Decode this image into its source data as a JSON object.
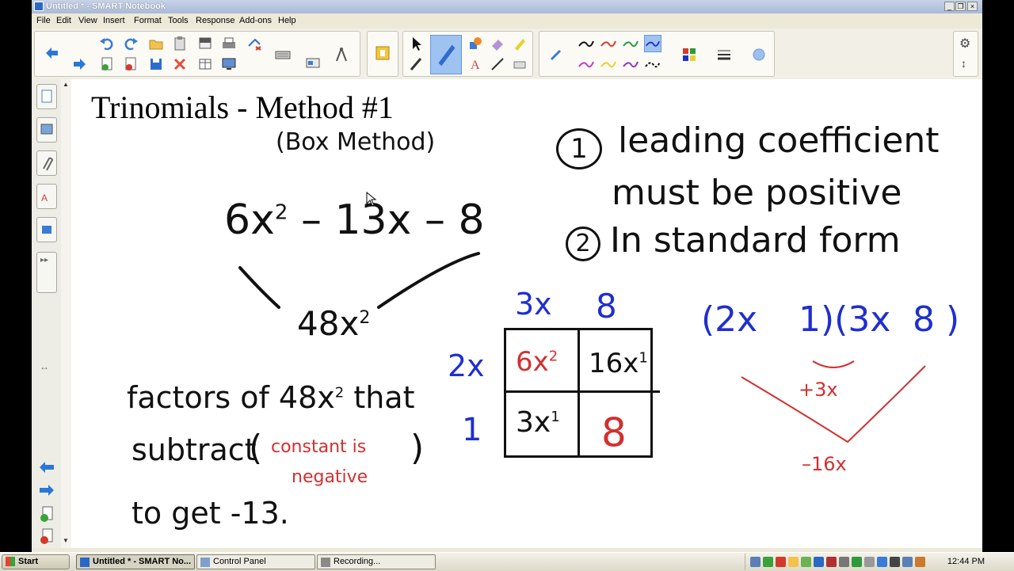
{
  "window": {
    "title": "Untitled * - SMART Notebook"
  },
  "menu": [
    "File",
    "Edit",
    "View",
    "Insert",
    "Format",
    "Tools",
    "Response",
    "Add-ons",
    "Help"
  ],
  "page": {
    "title": "Trinomials - Method #1",
    "subtitle": "(Box Method)",
    "expression": {
      "a": "6x",
      "a_exp": "2",
      "rest": "– 13x – 8"
    },
    "product": {
      "base": "48x",
      "exp": "2"
    },
    "rules": {
      "n1": "1",
      "line1": "leading coefficient",
      "line2": "must be positive",
      "n2": "2",
      "line3": "In standard form"
    },
    "box": {
      "top": [
        "3x",
        "8"
      ],
      "left": [
        "2x",
        "1"
      ],
      "cells": [
        {
          "text": "6x",
          "exp": "2"
        },
        {
          "text": "16x",
          "exp": "1"
        },
        {
          "text": "3x",
          "exp": "1"
        },
        {
          "text": "8",
          "exp": ""
        }
      ]
    },
    "factored": {
      "part1": "(2x",
      "part2": "1)(3x",
      "part3": "8 )"
    },
    "sum_terms": [
      "+3x",
      "–16x"
    ],
    "factors_note": {
      "line1_pre": "factors of 48x",
      "line1_exp": "2",
      "line1_post": "that",
      "line2": "subtract",
      "paren_open": "(",
      "constant_note1": "constant is",
      "constant_note2": "negative",
      "paren_close": ")",
      "line3": "to get -13."
    }
  },
  "taskbar": {
    "start": "Start",
    "tasks": [
      "Untitled * - SMART No...",
      "Control Panel",
      "Recording..."
    ],
    "clock": "12:44 PM"
  },
  "colors": {
    "ink": "#111111",
    "blue": "#1f2fcf",
    "red": "#d23030",
    "select": "#9fc3f0"
  }
}
